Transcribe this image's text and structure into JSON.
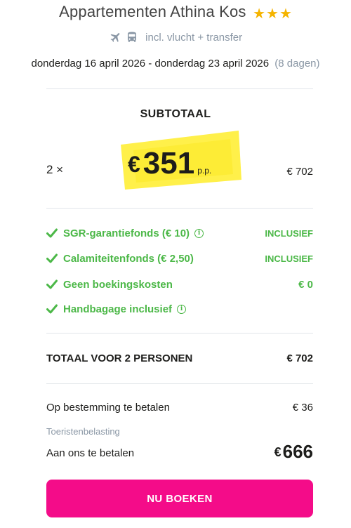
{
  "header": {
    "title": "Appartementen Athina Kos",
    "stars": 3,
    "includes": "incl. vlucht + transfer",
    "icons": [
      "airplane-icon",
      "bus-icon"
    ],
    "dates": "donderdag 16 april 2026 - donderdag 23 april 2026",
    "duration": "(8 dagen)"
  },
  "subtotal": {
    "title": "SUBTOTAAL",
    "quantity": "2 ×",
    "price_currency": "€",
    "price_amount": "351",
    "price_suffix": "p.p.",
    "line_total": "€ 702"
  },
  "features": [
    {
      "label": "SGR-garantiefonds  (€ 10)",
      "info": true,
      "value": "INCLUSIEF"
    },
    {
      "label": "Calamiteitenfonds  (€ 2,50)",
      "info": false,
      "value": "INCLUSIEF"
    },
    {
      "label": "Geen boekingskosten",
      "info": false,
      "value": "€ 0"
    },
    {
      "label": "Handbagage inclusief",
      "info": true,
      "value": ""
    }
  ],
  "total": {
    "label": "TOTAAL VOOR 2 PERSONEN",
    "value": "€ 702"
  },
  "payments": {
    "destination_label": "Op bestemming te betalen",
    "destination_value": "€ 36",
    "destination_note": "Toeristenbelasting",
    "pay_label": "Aan ons te betalen",
    "pay_currency": "€",
    "pay_amount": "666"
  },
  "cta": {
    "label": "NU BOEKEN"
  },
  "colors": {
    "accent_pink": "#f40c89",
    "highlight_yellow": "#fff04a",
    "check_green": "#4cb848",
    "star_gold": "#f5b400",
    "muted_text": "#8a97a5"
  }
}
